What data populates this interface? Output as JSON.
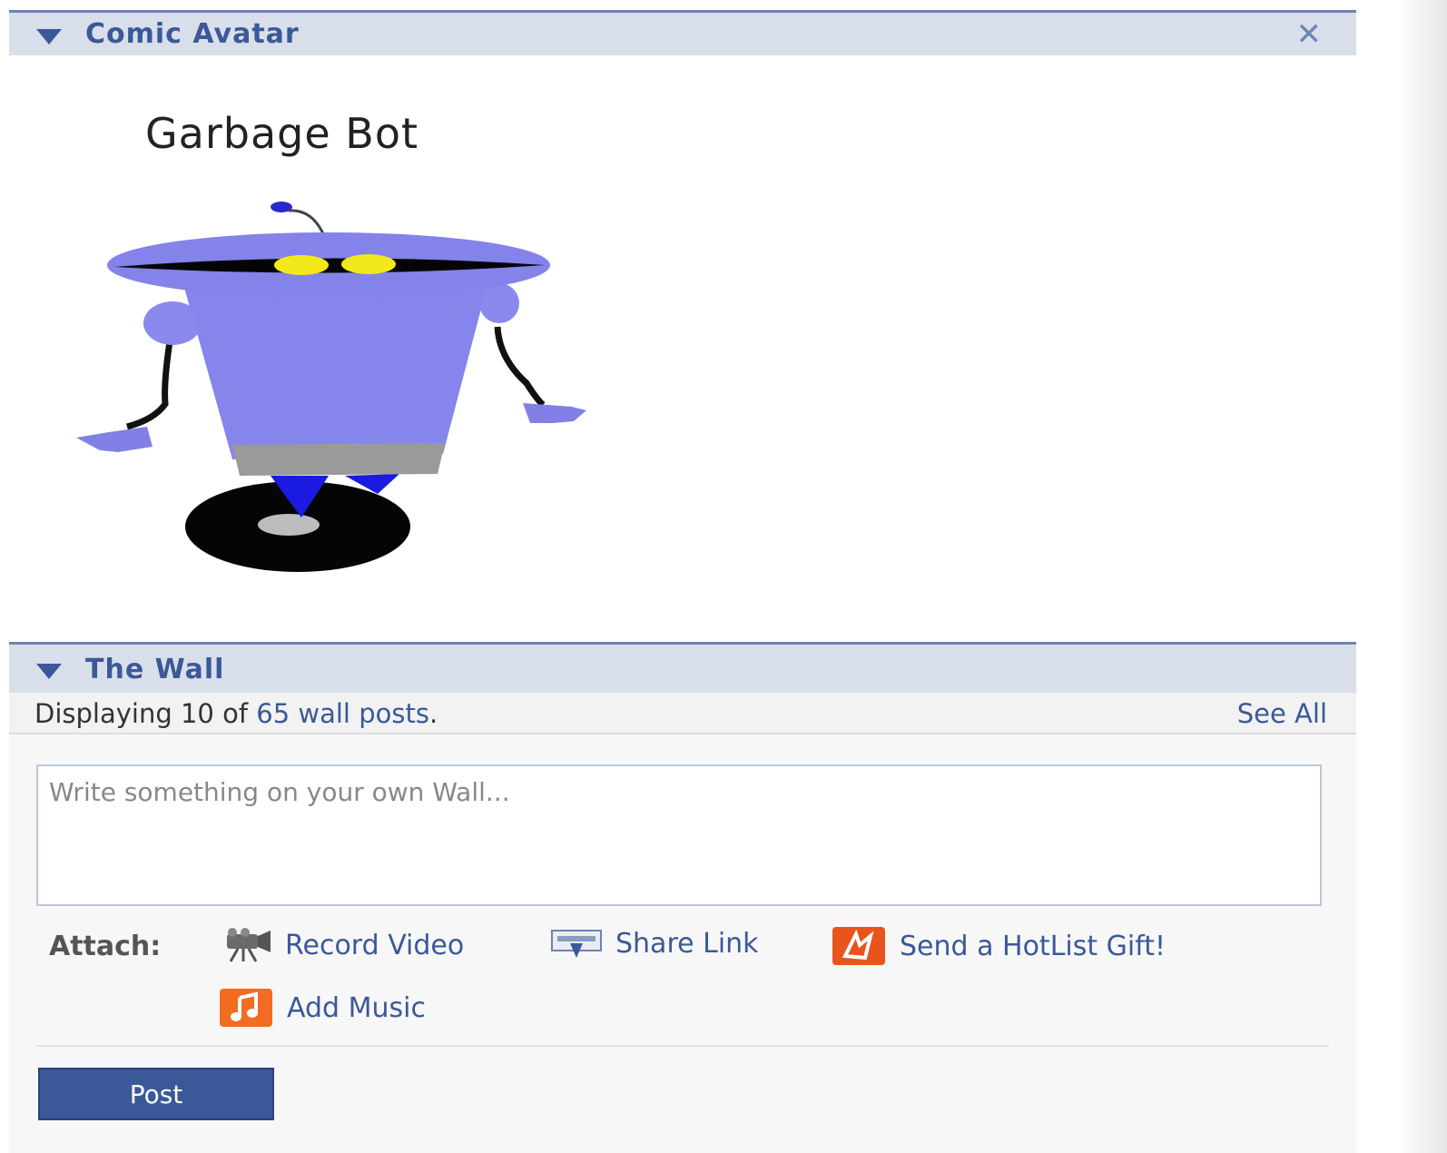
{
  "avatar_box": {
    "title": "Comic Avatar",
    "close_glyph": "✕",
    "avatar_name": "Garbage Bot",
    "avatar_image_icon": "robot-avatar-illustration"
  },
  "wall_box": {
    "title": "The Wall",
    "count_prefix": "Displaying 10 of ",
    "count_link": "65 wall posts",
    "count_suffix": ".",
    "see_all": "See All",
    "input_placeholder": "Write something on your own Wall...",
    "attach_label": "Attach:",
    "attachments": [
      {
        "label": "Record Video",
        "icon": "video-camera-icon"
      },
      {
        "label": "Share Link",
        "icon": "share-link-icon"
      },
      {
        "label": "Send a HotList Gift!",
        "icon": "hotlist-gift-icon"
      },
      {
        "label": "Add Music",
        "icon": "music-note-icon"
      }
    ],
    "post_button": "Post"
  },
  "colors": {
    "header_bg": "#d8dfea",
    "header_border": "#6d84b4",
    "link": "#3b5998",
    "button_bg": "#3b5998",
    "gift_orange": "#e8541c",
    "music_orange": "#f26c22"
  }
}
